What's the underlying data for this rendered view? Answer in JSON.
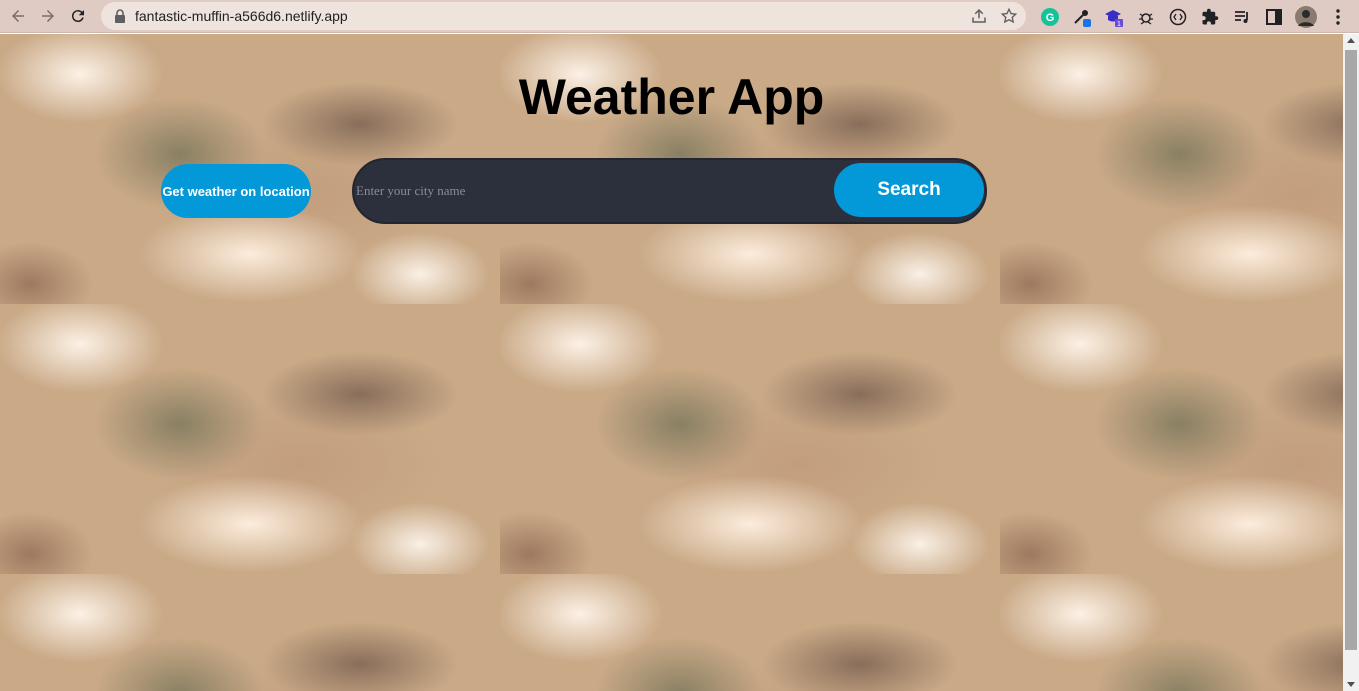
{
  "browser": {
    "url": "fantastic-muffin-a566d6.netlify.app",
    "extension_badge": "1"
  },
  "icons": {
    "back": "arrow-left-icon",
    "forward": "arrow-right-icon",
    "reload": "reload-icon",
    "lock": "lock-icon",
    "share": "share-icon",
    "bookmark": "star-icon",
    "grammarly": "grammarly-icon",
    "extensions": "puzzle-icon",
    "menu": "kebab-menu-icon"
  },
  "app": {
    "title": "Weather App",
    "location_button": "Get weather on location",
    "search_placeholder": "Enter your city name",
    "search_button": "Search"
  },
  "colors": {
    "accent": "#0398d8",
    "search_bar": "#2c303d",
    "chrome": "#dfcbc3"
  }
}
